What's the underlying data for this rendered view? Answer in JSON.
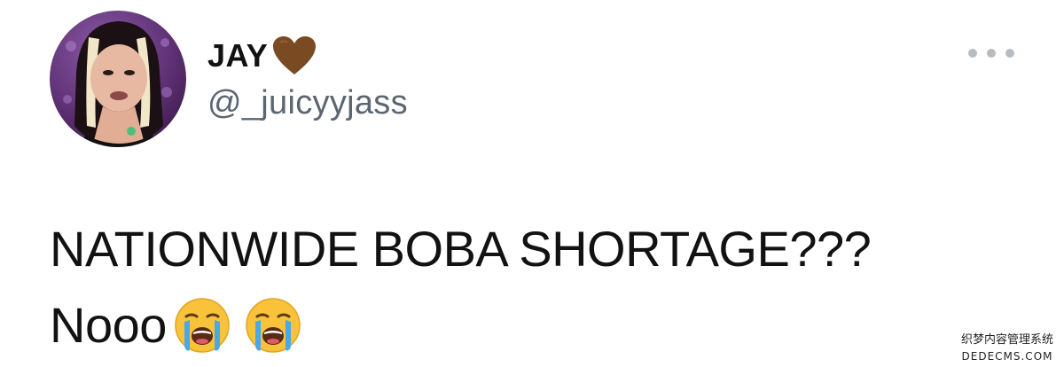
{
  "tweet": {
    "author": {
      "display_name": "JAY",
      "handle": "@_juicyyjass",
      "avatar_icon": "profile-photo",
      "name_emoji": "brown-heart-icon"
    },
    "more_icon": "more-horizontal-icon",
    "text": {
      "line1": "NATIONWIDE BOBA SHORTAGE???",
      "line2": "Nooo",
      "emojis": [
        "loudly-crying-face-icon",
        "loudly-crying-face-icon"
      ]
    }
  },
  "watermark": {
    "line1": "织梦内容管理系统",
    "line2": "DEDECMS.COM"
  },
  "colors": {
    "text": "#121212",
    "handle": "#5b6670",
    "more_dots": "#b6bcc2",
    "heart": "#7a4a22"
  }
}
